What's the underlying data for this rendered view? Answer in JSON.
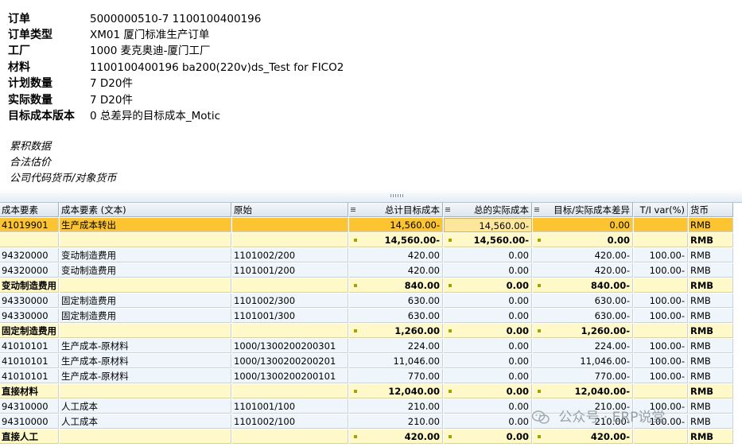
{
  "header": {
    "fields": [
      {
        "label": "订单",
        "value": "5000000510-7 1100100400196"
      },
      {
        "label": "订单类型",
        "value": "XM01 厦门标准生产订单"
      },
      {
        "label": "工厂",
        "value": "1000 麦克奥迪-厦门工厂"
      },
      {
        "label": "材料",
        "value": "1100100400196 ba200(220v)ds_Test for FICO2"
      },
      {
        "label": "计划数量",
        "value": "7 D20件"
      },
      {
        "label": "实际数量",
        "value": "7 D20件"
      },
      {
        "label": "目标成本版本",
        "value": "0 总差异的目标成本_Motic"
      }
    ],
    "notes": [
      "累积数据",
      "合法估价",
      "公司代码货币/对象货币"
    ]
  },
  "table": {
    "columns": [
      "成本要素",
      "成本要素 (文本)",
      "原始",
      "总计目标成本",
      "总的实际成本",
      "目标/实际成本差异",
      "T/I var(%)",
      "货币"
    ],
    "rows": [
      {
        "type": "highlight",
        "cells": [
          "41019901",
          "生产成本转出",
          "",
          "14,560.00-",
          "14,560.00-",
          "0.00",
          "",
          "RMB"
        ]
      },
      {
        "type": "subtotal",
        "cells": [
          "",
          "",
          "",
          "14,560.00-",
          "14,560.00-",
          "0.00",
          "",
          "RMB"
        ]
      },
      {
        "type": "detail",
        "cells": [
          "94320000",
          "变动制造费用",
          "1101002/200",
          "420.00",
          "0.00",
          "420.00-",
          "100.00-",
          "RMB"
        ]
      },
      {
        "type": "detail",
        "cells": [
          "94320000",
          "变动制造费用",
          "1101001/200",
          "420.00",
          "0.00",
          "420.00-",
          "100.00-",
          "RMB"
        ]
      },
      {
        "type": "subtotal",
        "cells": [
          "变动制造费用",
          "",
          "",
          "840.00",
          "0.00",
          "840.00-",
          "",
          "RMB"
        ]
      },
      {
        "type": "detail",
        "cells": [
          "94330000",
          "固定制造费用",
          "1101002/300",
          "630.00",
          "0.00",
          "630.00-",
          "100.00-",
          "RMB"
        ]
      },
      {
        "type": "detail",
        "cells": [
          "94330000",
          "固定制造费用",
          "1101001/300",
          "630.00",
          "0.00",
          "630.00-",
          "100.00-",
          "RMB"
        ]
      },
      {
        "type": "subtotal",
        "cells": [
          "固定制造费用",
          "",
          "",
          "1,260.00",
          "0.00",
          "1,260.00-",
          "",
          "RMB"
        ]
      },
      {
        "type": "detail",
        "cells": [
          "41010101",
          "生产成本-原材料",
          "1000/1300200200301",
          "224.00",
          "0.00",
          "224.00-",
          "100.00-",
          "RMB"
        ]
      },
      {
        "type": "detail",
        "cells": [
          "41010101",
          "生产成本-原材料",
          "1000/1300200200201",
          "11,046.00",
          "0.00",
          "11,046.00-",
          "100.00-",
          "RMB"
        ]
      },
      {
        "type": "detail",
        "cells": [
          "41010101",
          "生产成本-原材料",
          "1000/1300200200101",
          "770.00",
          "0.00",
          "770.00-",
          "100.00-",
          "RMB"
        ]
      },
      {
        "type": "subtotal",
        "cells": [
          "直接材料",
          "",
          "",
          "12,040.00",
          "0.00",
          "12,040.00-",
          "",
          "RMB"
        ]
      },
      {
        "type": "detail",
        "cells": [
          "94310000",
          "人工成本",
          "1101001/100",
          "210.00",
          "0.00",
          "210.00-",
          "100.00-",
          "RMB"
        ]
      },
      {
        "type": "detail",
        "cells": [
          "94310000",
          "人工成本",
          "1101002/100",
          "210.00",
          "0.00",
          "210.00-",
          "100.00-",
          "RMB"
        ]
      },
      {
        "type": "subtotal",
        "cells": [
          "直接人工",
          "",
          "",
          "420.00",
          "0.00",
          "420.00-",
          "",
          "RMB"
        ]
      }
    ]
  },
  "watermark": {
    "text": "公众号 · ERP说堂",
    "icon": "wechat-icon"
  }
}
